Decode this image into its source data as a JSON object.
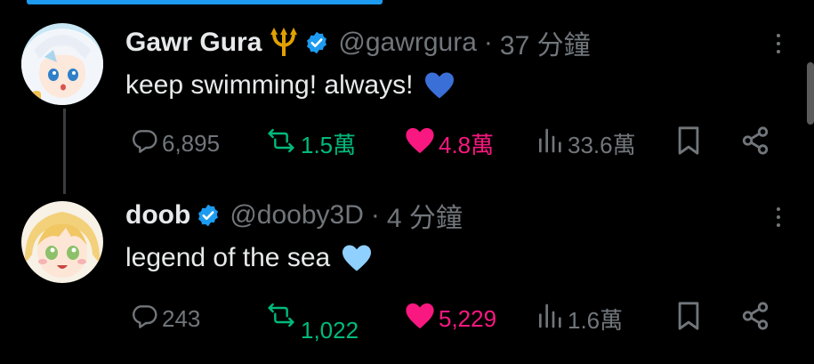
{
  "tweets": [
    {
      "name": "Gawr Gura",
      "handle": "@gawrgura",
      "dot": "·",
      "time": "37 分鐘",
      "text": "keep swimming! always!",
      "has_trident": true,
      "emoji_color": "#3b6fd8",
      "stats": {
        "replies": "6,895",
        "reposts": "1.5萬",
        "likes": "4.8萬",
        "views": "33.6萬"
      }
    },
    {
      "name": "doob",
      "handle": "@dooby3D",
      "dot": "·",
      "time": "4 分鐘",
      "text": "legend of the sea",
      "has_trident": false,
      "emoji_color": "#8fd0ff",
      "stats": {
        "replies": "243",
        "reposts": "1,022",
        "likes": "5,229",
        "views": "1.6萬"
      }
    }
  ],
  "colors": {
    "background": "#000000",
    "text": "#e7e9ea",
    "muted": "#71767b",
    "verified": "#1d9bf0",
    "repost": "#00ba7c",
    "like": "#f91880"
  },
  "icons": [
    "reply-icon",
    "repost-icon",
    "like-icon",
    "views-icon",
    "bookmark-icon",
    "share-icon",
    "verified-icon",
    "more-icon",
    "trident-icon"
  ]
}
